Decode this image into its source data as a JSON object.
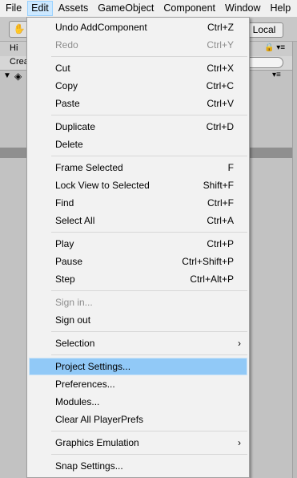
{
  "menubar": {
    "items": [
      {
        "label": "File"
      },
      {
        "label": "Edit",
        "active": true
      },
      {
        "label": "Assets"
      },
      {
        "label": "GameObject"
      },
      {
        "label": "Component"
      },
      {
        "label": "Window"
      },
      {
        "label": "Help"
      }
    ]
  },
  "editor": {
    "local_button": "Local",
    "hierarchy_tab": "Hi",
    "create_label": "Crea"
  },
  "edit_menu": {
    "items": [
      {
        "label": "Undo AddComponent",
        "shortcut": "Ctrl+Z"
      },
      {
        "label": "Redo",
        "shortcut": "Ctrl+Y",
        "disabled": true
      },
      {
        "label": "Cut",
        "shortcut": "Ctrl+X"
      },
      {
        "label": "Copy",
        "shortcut": "Ctrl+C"
      },
      {
        "label": "Paste",
        "shortcut": "Ctrl+V"
      },
      {
        "label": "Duplicate",
        "shortcut": "Ctrl+D"
      },
      {
        "label": "Delete",
        "shortcut": ""
      },
      {
        "label": "Frame Selected",
        "shortcut": "F"
      },
      {
        "label": "Lock View to Selected",
        "shortcut": "Shift+F"
      },
      {
        "label": "Find",
        "shortcut": "Ctrl+F"
      },
      {
        "label": "Select All",
        "shortcut": "Ctrl+A"
      },
      {
        "label": "Play",
        "shortcut": "Ctrl+P"
      },
      {
        "label": "Pause",
        "shortcut": "Ctrl+Shift+P"
      },
      {
        "label": "Step",
        "shortcut": "Ctrl+Alt+P"
      },
      {
        "label": "Sign in...",
        "shortcut": "",
        "disabled": true
      },
      {
        "label": "Sign out",
        "shortcut": ""
      },
      {
        "label": "Selection",
        "shortcut": "",
        "submenu": true
      },
      {
        "label": "Project Settings...",
        "shortcut": "",
        "highlighted": true
      },
      {
        "label": "Preferences...",
        "shortcut": ""
      },
      {
        "label": "Modules...",
        "shortcut": ""
      },
      {
        "label": "Clear All PlayerPrefs",
        "shortcut": ""
      },
      {
        "label": "Graphics Emulation",
        "shortcut": "",
        "submenu": true
      },
      {
        "label": "Snap Settings...",
        "shortcut": ""
      }
    ]
  }
}
